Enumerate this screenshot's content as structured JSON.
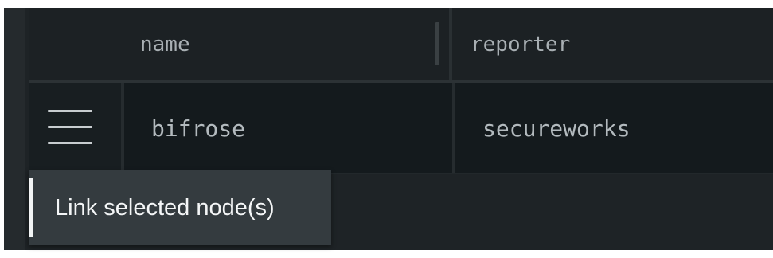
{
  "table": {
    "columns": [
      "name",
      "reporter"
    ],
    "rows": [
      {
        "name": "bifrose",
        "reporter": "secureworks"
      }
    ]
  },
  "tooltip": {
    "text": "Link selected node(s)"
  },
  "icons": {
    "row_handle": "menu-icon"
  },
  "colors": {
    "background": "#1e2326",
    "header_bg": "#1c2124",
    "row_bg": "#141a1d",
    "tooltip_bg": "#343b3f",
    "text_muted": "#a8afb3"
  }
}
